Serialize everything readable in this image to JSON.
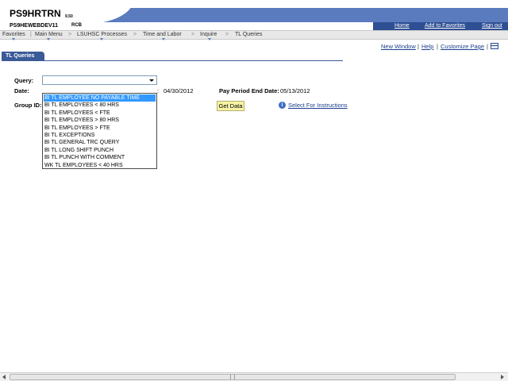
{
  "header": {
    "app_title": "PS9HRTRN",
    "app_version": "9.50",
    "server": "PS9HEWEBDEV11",
    "user": "RCB",
    "links": [
      "Home",
      "Add to Favorites",
      "Sign out"
    ]
  },
  "nav": {
    "items": [
      "Favorites",
      "Main Menu",
      "LSUHSC Processes",
      "Time and Labor",
      "Inquire",
      "TL Queries"
    ],
    "separator": ">"
  },
  "page_links": [
    "New Window",
    "Help",
    "Customize Page"
  ],
  "tab": {
    "label": "TL Queries"
  },
  "form": {
    "query_label": "Query:",
    "query_value": "",
    "date_label": "Date:",
    "begin_date_suffix": ":",
    "begin_date_value": "04/30/2012",
    "end_date_label": "Pay Period End Date:",
    "end_date_value": "05/13/2012",
    "group_id_label": "Group ID:",
    "get_data_label": "Get Data",
    "instructions_link": "Select For Instructions",
    "options": [
      "BI TL EMPLOYEE NO PAYABLE TIME",
      "BI TL EMPLOYEES < 80 HRS",
      "BI TL EMPLOYEES < FTE",
      "BI TL EMPLOYEES > 80 HRS",
      "BI TL EMPLOYEES > FTE",
      "BI TL EXCEPTIONS",
      "BI TL GENERAL TRC QUERY",
      "BI TL LONG SHIFT PUNCH",
      "BI TL PUNCH WITH COMMENT",
      "WK TL EMPLOYEES < 40 HRS"
    ],
    "highlighted_option": "BI TL EMPLOYEE NO PAYABLE TIME"
  },
  "colors": {
    "header_band": "#5b7bbf",
    "tab": "#3a5a98",
    "link": "#1b3f8f",
    "highlight": "#3399ff",
    "button": "#f7f3a5"
  },
  "icons": {
    "info": "info-icon",
    "customize": "grid-icon",
    "dropdown": "chevron-down-icon"
  }
}
